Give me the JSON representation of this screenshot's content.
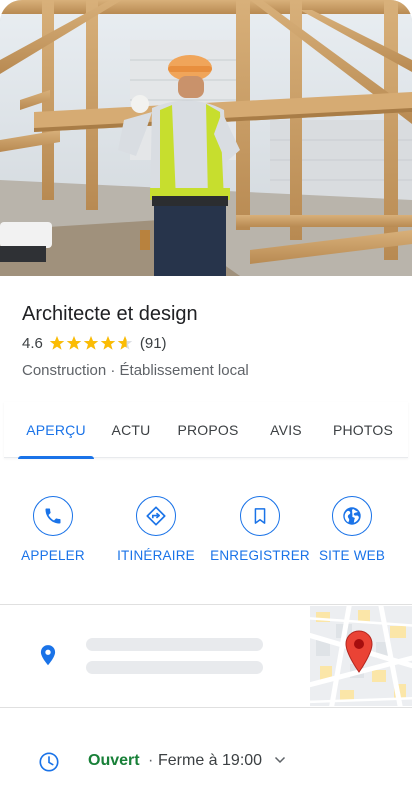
{
  "place": {
    "name": "Architecte et design",
    "rating": "4.6",
    "rating_value": 4.6,
    "star_count": 5,
    "reviews": "(91)",
    "category": "Construction · Établissement local"
  },
  "tabs": [
    {
      "label": "APERÇU",
      "active": true
    },
    {
      "label": "ACTU",
      "active": false
    },
    {
      "label": "PROPOS",
      "active": false
    },
    {
      "label": "AVIS",
      "active": false
    },
    {
      "label": "PHOTOS",
      "active": false
    }
  ],
  "actions": [
    {
      "label": "APPELER",
      "icon": "phone-icon"
    },
    {
      "label": "ITINÉRAIRE",
      "icon": "directions-icon"
    },
    {
      "label": "ENREGISTRER",
      "icon": "bookmark-icon"
    },
    {
      "label": "SITE WEB",
      "icon": "globe-icon"
    }
  ],
  "hours": {
    "status": "Ouvert",
    "separator": "·",
    "closes": "Ferme à 19:00"
  },
  "colors": {
    "accent": "#1a73e8",
    "star": "#fbbc04",
    "open": "#188038",
    "map_pin": "#ea4335"
  }
}
